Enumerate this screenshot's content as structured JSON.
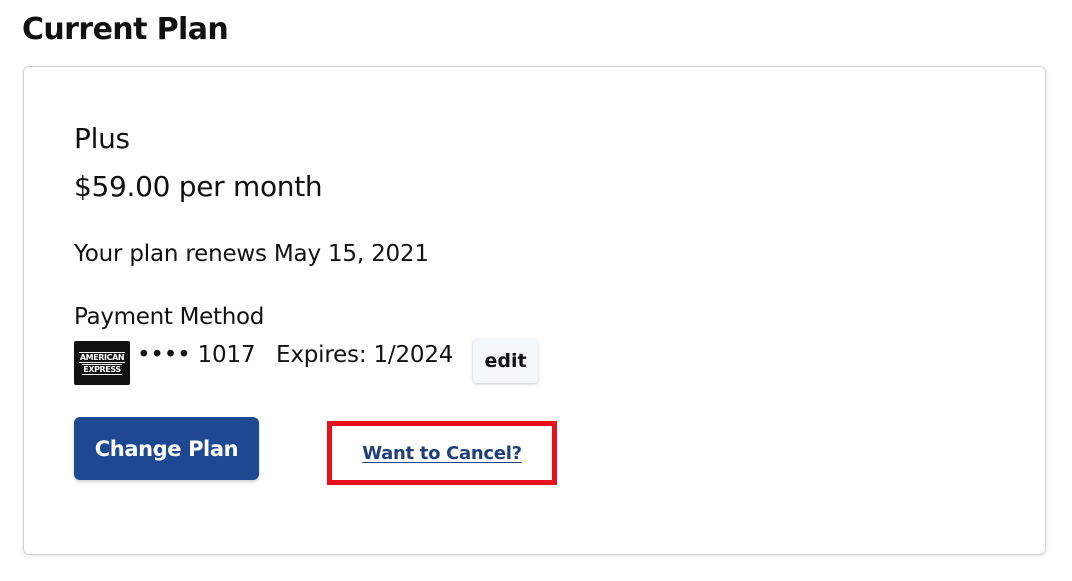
{
  "page": {
    "title": "Current Plan"
  },
  "plan": {
    "name": "Plus",
    "price": "$59.00 per month",
    "renewal": "Your plan renews May 15, 2021"
  },
  "payment": {
    "heading": "Payment Method",
    "card_brand_line1": "AMERICAN",
    "card_brand_line2": "EXPRESS",
    "card_number": "•••• 1017",
    "expiry": "Expires: 1/2024",
    "edit_label": "edit"
  },
  "actions": {
    "change_plan_label": "Change Plan",
    "cancel_label": "Want to Cancel?"
  },
  "colors": {
    "primary_button": "#1e4891",
    "link": "#1f3f7a",
    "highlight_box": "#e8111b"
  }
}
